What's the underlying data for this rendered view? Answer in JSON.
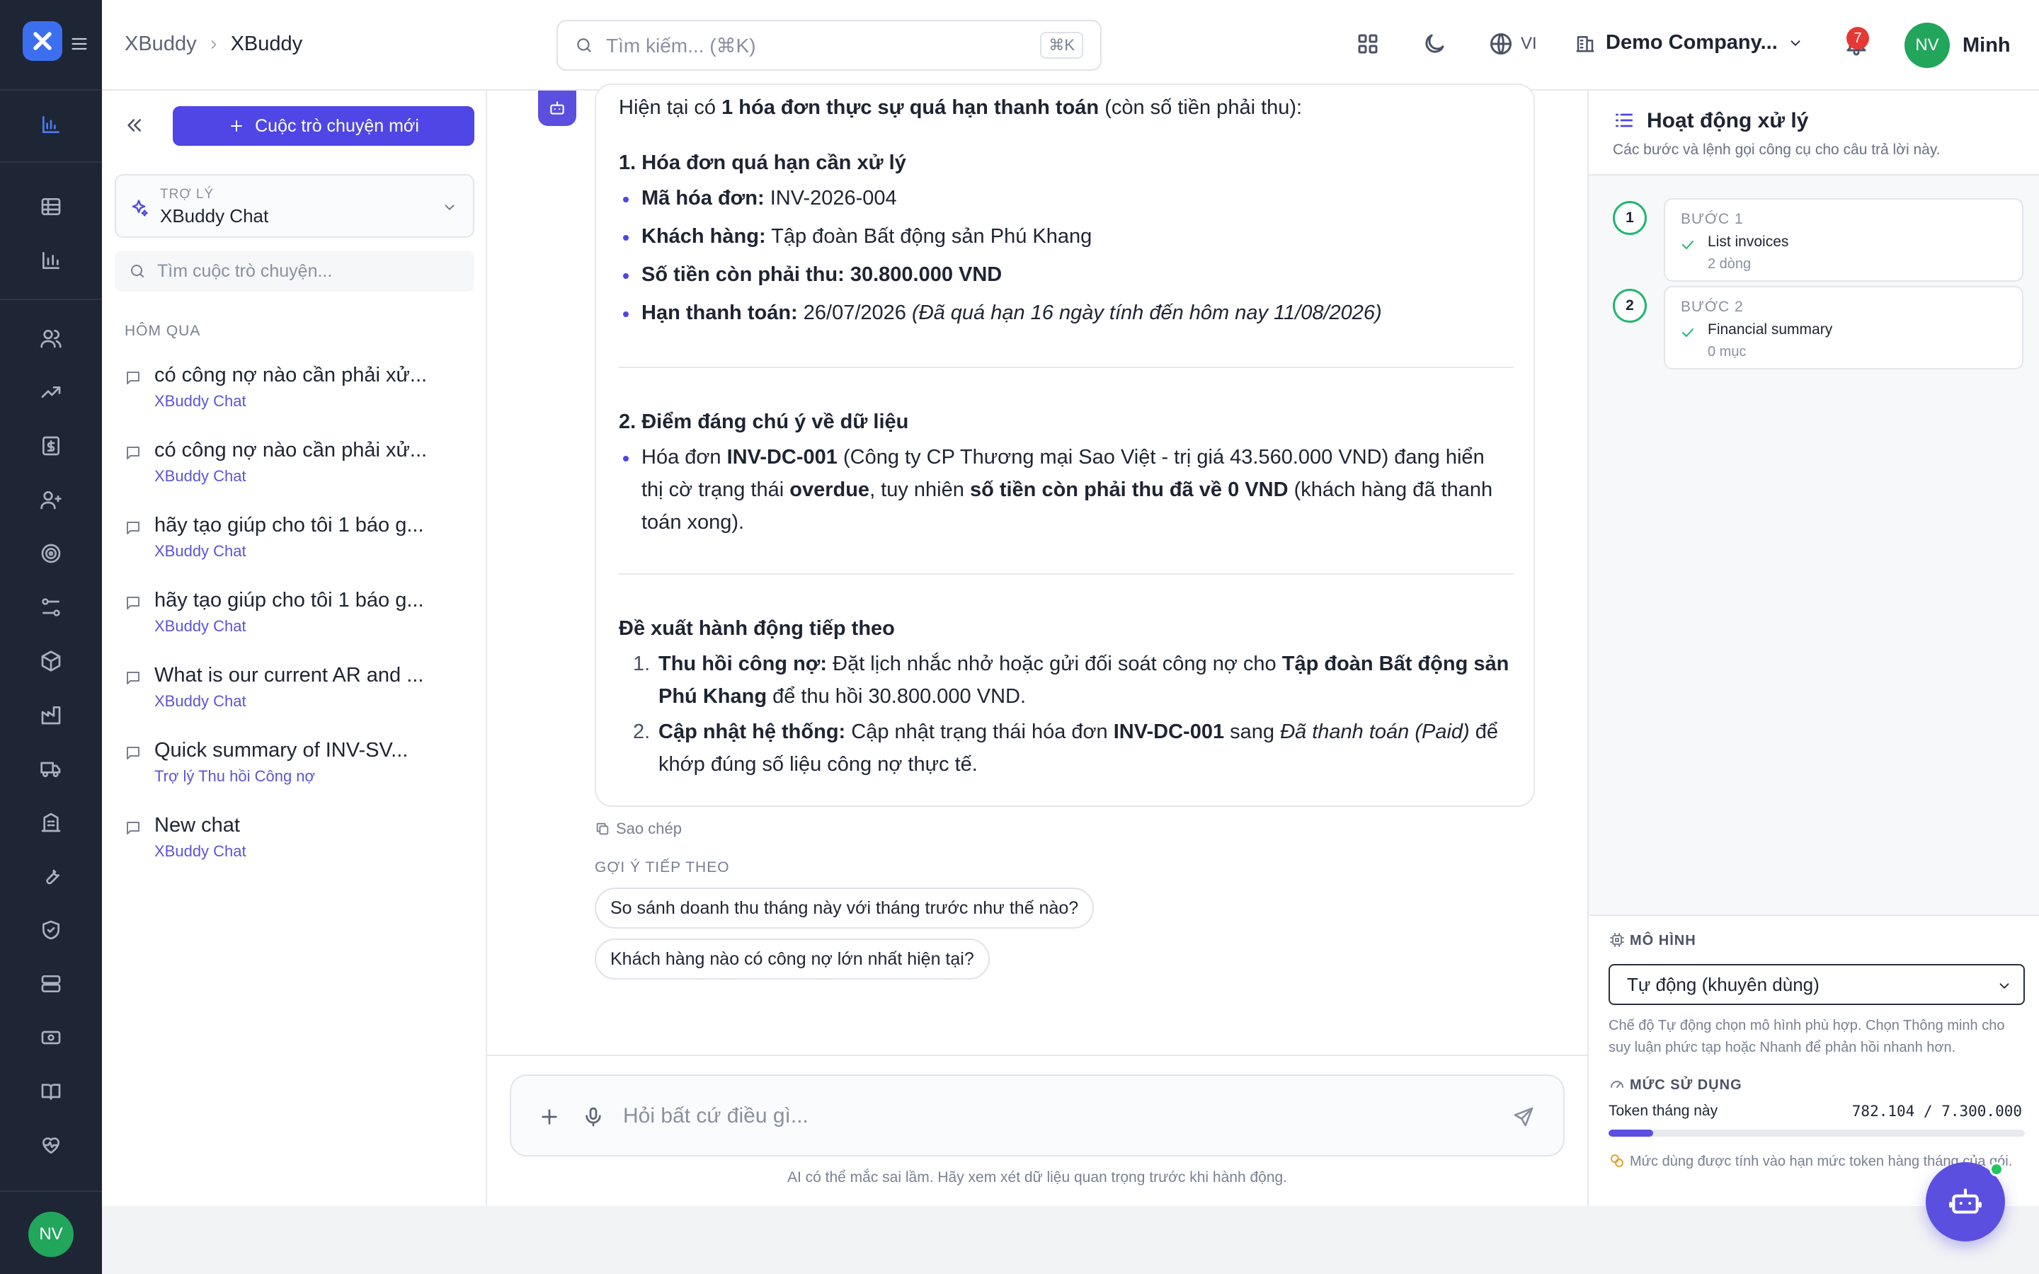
{
  "rail": {
    "avatar": "NV"
  },
  "header": {
    "breadcrumb": [
      "XBuddy",
      "XBuddy"
    ],
    "search_placeholder": "Tìm kiếm... (⌘K)",
    "search_shortcut": "⌘K",
    "language": "VI",
    "company": "Demo Company...",
    "notifications": "7",
    "user_initials": "NV",
    "user_name": "Minh"
  },
  "sidebar": {
    "new_chat": "Cuộc trò chuyện mới",
    "assistant_label": "TRỢ LÝ",
    "assistant_value": "XBuddy Chat",
    "search_placeholder": "Tìm cuộc trò chuyện...",
    "section": "HÔM QUA",
    "items": [
      {
        "title": "có công nợ nào cần phải xử...",
        "assistant": "XBuddy Chat"
      },
      {
        "title": "có công nợ nào cần phải xử...",
        "assistant": "XBuddy Chat"
      },
      {
        "title": "hãy tạo giúp cho tôi 1 báo g...",
        "assistant": "XBuddy Chat"
      },
      {
        "title": "hãy tạo giúp cho tôi 1 báo g...",
        "assistant": "XBuddy Chat"
      },
      {
        "title": "What is our current AR and ...",
        "assistant": "XBuddy Chat"
      },
      {
        "title": "Quick summary of INV-SV...",
        "assistant": "Trợ lý Thu hồi Công nợ"
      },
      {
        "title": "New chat",
        "assistant": "XBuddy Chat"
      }
    ]
  },
  "message": {
    "intro_a": "Hiện tại có ",
    "intro_b": "1 hóa đơn thực sự quá hạn thanh toán",
    "intro_c": " (còn số tiền phải thu):",
    "h1": "1. Hóa đơn quá hạn cần xử lý",
    "b1_label": "Mã hóa đơn:",
    "b1_value": " INV-2026-004",
    "b2_label": "Khách hàng:",
    "b2_value": " Tập đoàn Bất động sản Phú Khang",
    "b3_label": "Số tiền còn phải thu: 30.800.000 VND",
    "b4_label": "Hạn thanh toán:",
    "b4_value": " 26/07/2026 ",
    "b4_note": "(Đã quá hạn 16 ngày tính đến hôm nay 11/08/2026)",
    "h2": "2. Điểm đáng chú ý về dữ liệu",
    "n1_a": "Hóa đơn ",
    "n1_b": "INV-DC-001",
    "n1_c": " (Công ty CP Thương mại Sao Việt - trị giá 43.560.000 VND) đang hiển",
    "n2_a": "thị cờ trạng thái ",
    "n2_b": "overdue",
    "n2_c": ", tuy nhiên ",
    "n2_d": "số tiền còn phải thu đã về 0 VND",
    "n2_e": " (khách hàng đã thanh",
    "n3": "toán xong).",
    "h3": "Đề xuất hành động tiếp theo",
    "a1_num": "1.",
    "a1_label": "Thu hồi công nợ:",
    "a1_text": " Đặt lịch nhắc nhở hoặc gửi đối soát công nợ cho ",
    "a1_bold": "Tập đoàn Bất động sản",
    "a1_line2_bold": "Phú Khang",
    "a1_line2": " để thu hồi 30.800.000 VND.",
    "a2_num": "2.",
    "a2_label": "Cập nhật hệ thống:",
    "a2_text": " Cập nhật trạng thái hóa đơn ",
    "a2_bold": "INV-DC-001",
    "a2_text2": " sang ",
    "a2_italic": "Đã thanh toán (Paid)",
    "a2_text3": " để",
    "a2_line2": "khớp đúng số liệu công nợ thực tế."
  },
  "chat": {
    "copy": "Sao chép",
    "suggest_label": "GỢI Ý TIẾP THEO",
    "suggestions": [
      "So sánh doanh thu tháng này với tháng trước như thế nào?",
      "Khách hàng nào có công nợ lớn nhất hiện tại?"
    ],
    "composer_placeholder": "Hỏi bất cứ điều gì...",
    "disclaimer": "AI có thể mắc sai lầm. Hãy xem xét dữ liệu quan trọng trước khi hành động."
  },
  "panel": {
    "title": "Hoạt động xử lý",
    "subtitle": "Các bước và lệnh gọi công cụ cho câu trả lời này.",
    "steps": [
      {
        "num": "1",
        "label": "BƯỚC 1",
        "name": "List invoices",
        "count": "2 dòng"
      },
      {
        "num": "2",
        "label": "BƯỚC 2",
        "name": "Financial summary",
        "count": "0 mục"
      }
    ],
    "model_label": "MÔ HÌNH",
    "model_value": "Tự động (khuyên dùng)",
    "model_note": "Chế độ Tự động chọn mô hình phù hợp. Chọn Thông minh cho suy luận phức tạp hoặc Nhanh để phản hồi nhanh hơn.",
    "usage_label": "MỨC SỬ DỤNG",
    "tokens_label": "Token tháng này",
    "tokens_value": "782.104 / 7.300.000",
    "tokens_fraction": 0.107,
    "usage_note": "Mức dùng được tính vào hạn mức token hàng tháng của gói."
  }
}
